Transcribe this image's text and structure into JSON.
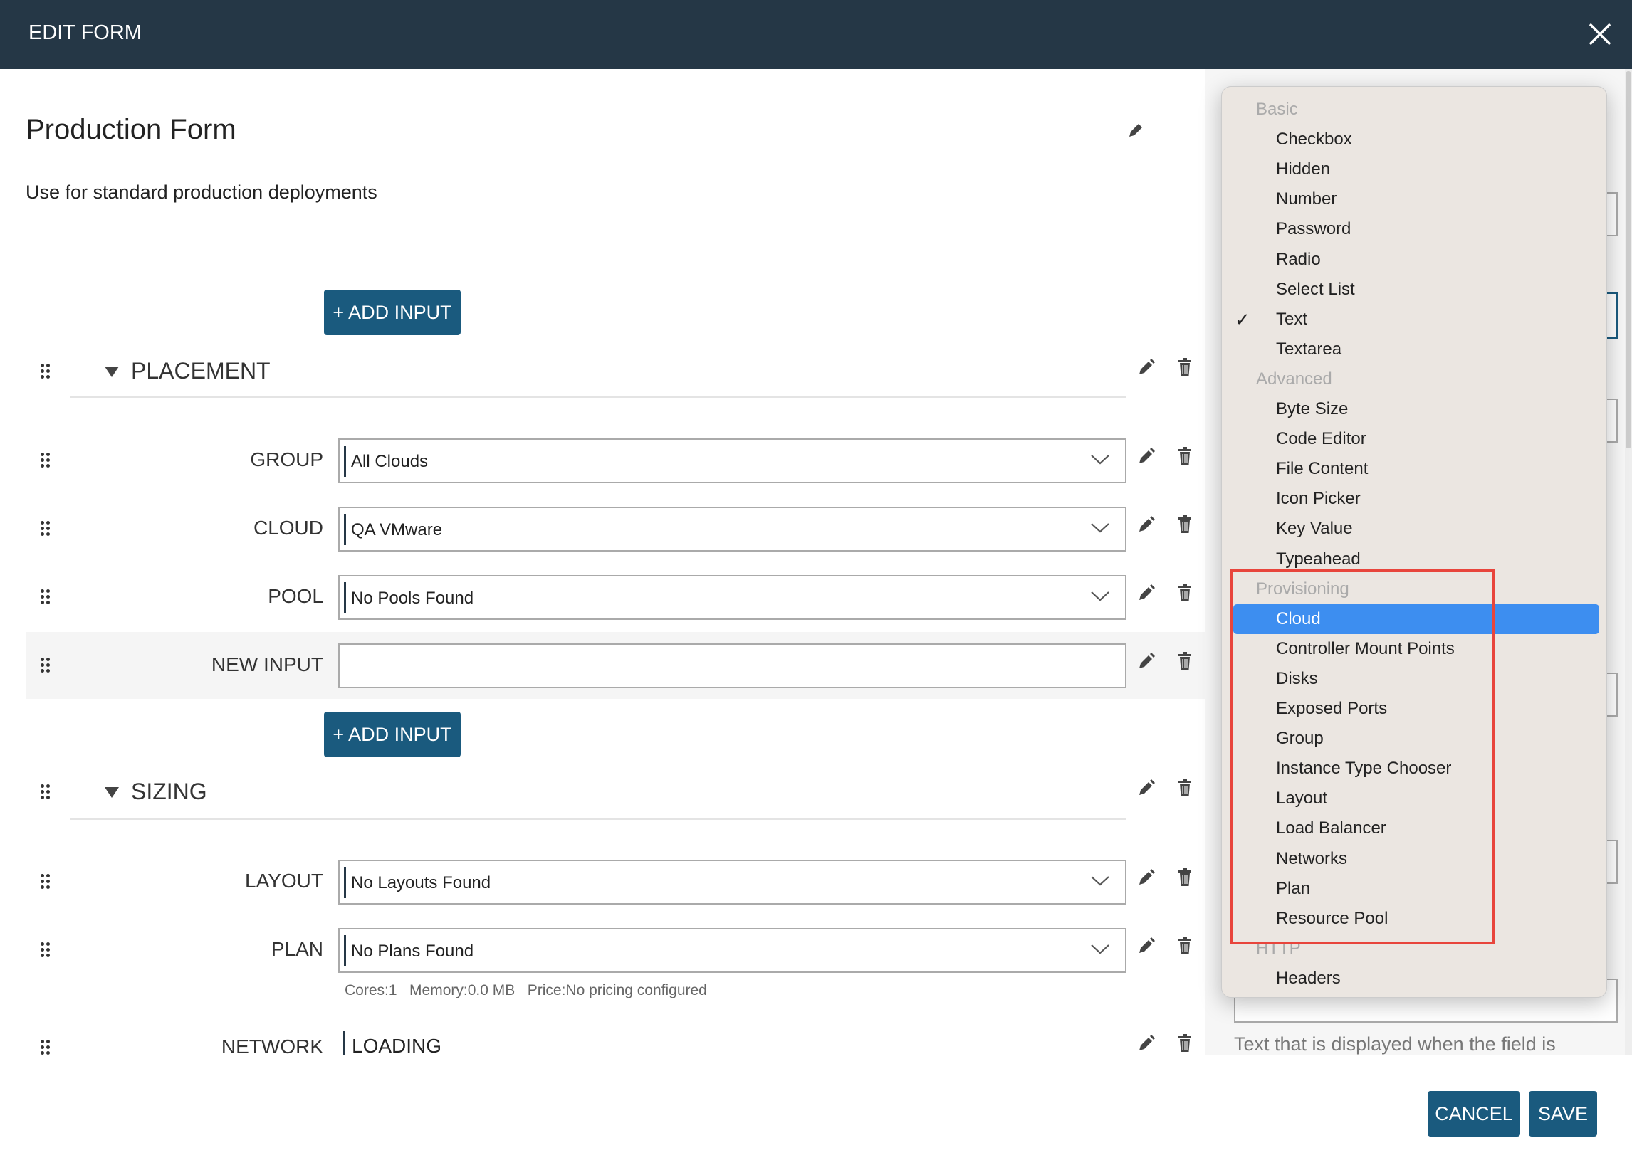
{
  "header": {
    "title": "EDIT FORM"
  },
  "form": {
    "name": "Production Form",
    "description": "Use for standard production deployments",
    "add_input_label": "+ ADD INPUT"
  },
  "sections": [
    {
      "title": "PLACEMENT",
      "inputs": [
        {
          "label": "GROUP",
          "value": "All Clouds",
          "type": "select"
        },
        {
          "label": "CLOUD",
          "value": "QA VMware",
          "type": "select"
        },
        {
          "label": "POOL",
          "value": "No Pools Found",
          "type": "select"
        },
        {
          "label": "NEW INPUT",
          "value": "",
          "type": "text",
          "highlighted": true
        }
      ]
    },
    {
      "title": "SIZING",
      "inputs": [
        {
          "label": "LAYOUT",
          "value": "No Layouts Found",
          "type": "select"
        },
        {
          "label": "PLAN",
          "value": "No Plans Found",
          "type": "select",
          "hint": "Cores:1   Memory:0.0 MB   Price:No pricing configured"
        },
        {
          "label": "NETWORK",
          "value": "LOADING",
          "type": "loading"
        }
      ]
    }
  ],
  "right_panel": {
    "help_text": "Text that is displayed when the field is"
  },
  "dropdown": {
    "selected": "Cloud",
    "checked": "Text",
    "groups": [
      {
        "label": "Basic",
        "items": [
          "Checkbox",
          "Hidden",
          "Number",
          "Password",
          "Radio",
          "Select List",
          "Text",
          "Textarea"
        ]
      },
      {
        "label": "Advanced",
        "items": [
          "Byte Size",
          "Code Editor",
          "File Content",
          "Icon Picker",
          "Key Value",
          "Typeahead"
        ]
      },
      {
        "label": "Provisioning",
        "items": [
          "Cloud",
          "Controller Mount Points",
          "Disks",
          "Exposed Ports",
          "Group",
          "Instance Type Chooser",
          "Layout",
          "Load Balancer",
          "Networks",
          "Plan",
          "Resource Pool"
        ]
      },
      {
        "label": "HTTP",
        "items": [
          "Headers"
        ]
      }
    ]
  },
  "footer": {
    "cancel_label": "CANCEL",
    "save_label": "SAVE"
  },
  "colors": {
    "header": "#253746",
    "button": "#1a5a7e",
    "selection": "#3d8ef0",
    "annotation": "#e8453c"
  }
}
